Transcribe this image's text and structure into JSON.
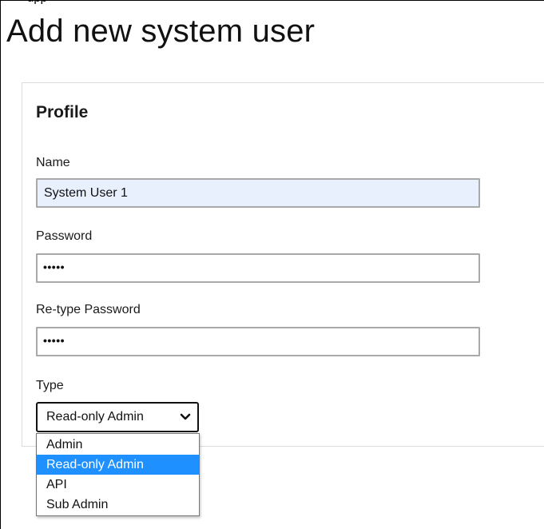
{
  "header": {
    "top_strip_text": "upp",
    "page_title": "Add new system user"
  },
  "profile": {
    "section_title": "Profile",
    "name": {
      "label": "Name",
      "value": "System User 1"
    },
    "password": {
      "label": "Password",
      "masked_value": "•••••"
    },
    "retype_password": {
      "label": "Re-type Password",
      "masked_value": "•••••"
    },
    "type": {
      "label": "Type",
      "selected": "Read-only Admin",
      "options": [
        "Admin",
        "Read-only Admin",
        "API",
        "Sub Admin"
      ],
      "highlighted_index": 1
    }
  },
  "icons": {
    "dropdown_toggle": "chevron-down-icon"
  },
  "colors": {
    "autofill_bg": "#e8f0fe",
    "highlight": "#1e90ff",
    "input_border": "#a9a9a9"
  }
}
